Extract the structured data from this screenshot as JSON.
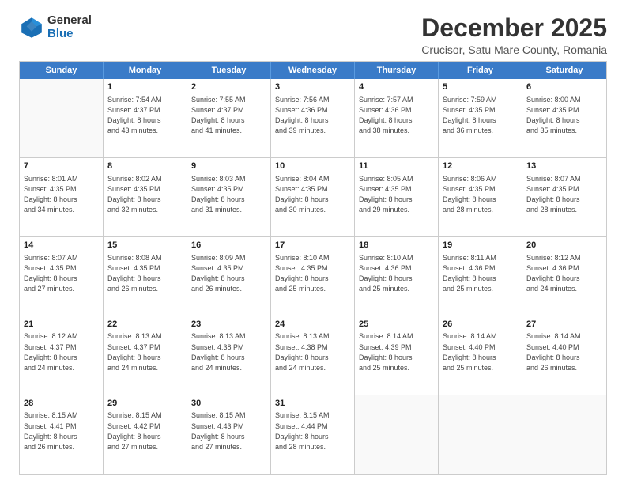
{
  "logo": {
    "general": "General",
    "blue": "Blue"
  },
  "header": {
    "month": "December 2025",
    "location": "Crucisor, Satu Mare County, Romania"
  },
  "days": [
    "Sunday",
    "Monday",
    "Tuesday",
    "Wednesday",
    "Thursday",
    "Friday",
    "Saturday"
  ],
  "weeks": [
    [
      {
        "day": "",
        "info": ""
      },
      {
        "day": "1",
        "info": "Sunrise: 7:54 AM\nSunset: 4:37 PM\nDaylight: 8 hours\nand 43 minutes."
      },
      {
        "day": "2",
        "info": "Sunrise: 7:55 AM\nSunset: 4:37 PM\nDaylight: 8 hours\nand 41 minutes."
      },
      {
        "day": "3",
        "info": "Sunrise: 7:56 AM\nSunset: 4:36 PM\nDaylight: 8 hours\nand 39 minutes."
      },
      {
        "day": "4",
        "info": "Sunrise: 7:57 AM\nSunset: 4:36 PM\nDaylight: 8 hours\nand 38 minutes."
      },
      {
        "day": "5",
        "info": "Sunrise: 7:59 AM\nSunset: 4:35 PM\nDaylight: 8 hours\nand 36 minutes."
      },
      {
        "day": "6",
        "info": "Sunrise: 8:00 AM\nSunset: 4:35 PM\nDaylight: 8 hours\nand 35 minutes."
      }
    ],
    [
      {
        "day": "7",
        "info": "Sunrise: 8:01 AM\nSunset: 4:35 PM\nDaylight: 8 hours\nand 34 minutes."
      },
      {
        "day": "8",
        "info": "Sunrise: 8:02 AM\nSunset: 4:35 PM\nDaylight: 8 hours\nand 32 minutes."
      },
      {
        "day": "9",
        "info": "Sunrise: 8:03 AM\nSunset: 4:35 PM\nDaylight: 8 hours\nand 31 minutes."
      },
      {
        "day": "10",
        "info": "Sunrise: 8:04 AM\nSunset: 4:35 PM\nDaylight: 8 hours\nand 30 minutes."
      },
      {
        "day": "11",
        "info": "Sunrise: 8:05 AM\nSunset: 4:35 PM\nDaylight: 8 hours\nand 29 minutes."
      },
      {
        "day": "12",
        "info": "Sunrise: 8:06 AM\nSunset: 4:35 PM\nDaylight: 8 hours\nand 28 minutes."
      },
      {
        "day": "13",
        "info": "Sunrise: 8:07 AM\nSunset: 4:35 PM\nDaylight: 8 hours\nand 28 minutes."
      }
    ],
    [
      {
        "day": "14",
        "info": "Sunrise: 8:07 AM\nSunset: 4:35 PM\nDaylight: 8 hours\nand 27 minutes."
      },
      {
        "day": "15",
        "info": "Sunrise: 8:08 AM\nSunset: 4:35 PM\nDaylight: 8 hours\nand 26 minutes."
      },
      {
        "day": "16",
        "info": "Sunrise: 8:09 AM\nSunset: 4:35 PM\nDaylight: 8 hours\nand 26 minutes."
      },
      {
        "day": "17",
        "info": "Sunrise: 8:10 AM\nSunset: 4:35 PM\nDaylight: 8 hours\nand 25 minutes."
      },
      {
        "day": "18",
        "info": "Sunrise: 8:10 AM\nSunset: 4:36 PM\nDaylight: 8 hours\nand 25 minutes."
      },
      {
        "day": "19",
        "info": "Sunrise: 8:11 AM\nSunset: 4:36 PM\nDaylight: 8 hours\nand 25 minutes."
      },
      {
        "day": "20",
        "info": "Sunrise: 8:12 AM\nSunset: 4:36 PM\nDaylight: 8 hours\nand 24 minutes."
      }
    ],
    [
      {
        "day": "21",
        "info": "Sunrise: 8:12 AM\nSunset: 4:37 PM\nDaylight: 8 hours\nand 24 minutes."
      },
      {
        "day": "22",
        "info": "Sunrise: 8:13 AM\nSunset: 4:37 PM\nDaylight: 8 hours\nand 24 minutes."
      },
      {
        "day": "23",
        "info": "Sunrise: 8:13 AM\nSunset: 4:38 PM\nDaylight: 8 hours\nand 24 minutes."
      },
      {
        "day": "24",
        "info": "Sunrise: 8:13 AM\nSunset: 4:38 PM\nDaylight: 8 hours\nand 24 minutes."
      },
      {
        "day": "25",
        "info": "Sunrise: 8:14 AM\nSunset: 4:39 PM\nDaylight: 8 hours\nand 25 minutes."
      },
      {
        "day": "26",
        "info": "Sunrise: 8:14 AM\nSunset: 4:40 PM\nDaylight: 8 hours\nand 25 minutes."
      },
      {
        "day": "27",
        "info": "Sunrise: 8:14 AM\nSunset: 4:40 PM\nDaylight: 8 hours\nand 26 minutes."
      }
    ],
    [
      {
        "day": "28",
        "info": "Sunrise: 8:15 AM\nSunset: 4:41 PM\nDaylight: 8 hours\nand 26 minutes."
      },
      {
        "day": "29",
        "info": "Sunrise: 8:15 AM\nSunset: 4:42 PM\nDaylight: 8 hours\nand 27 minutes."
      },
      {
        "day": "30",
        "info": "Sunrise: 8:15 AM\nSunset: 4:43 PM\nDaylight: 8 hours\nand 27 minutes."
      },
      {
        "day": "31",
        "info": "Sunrise: 8:15 AM\nSunset: 4:44 PM\nDaylight: 8 hours\nand 28 minutes."
      },
      {
        "day": "",
        "info": ""
      },
      {
        "day": "",
        "info": ""
      },
      {
        "day": "",
        "info": ""
      }
    ]
  ]
}
